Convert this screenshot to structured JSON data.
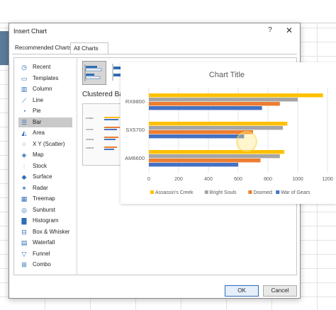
{
  "dialog": {
    "title": "Insert Chart",
    "help_glyph": "?",
    "close_glyph": "✕",
    "tabs": [
      {
        "label": "Recommended Charts"
      },
      {
        "label": "All Charts"
      }
    ],
    "categories": [
      {
        "label": "Recent",
        "icon": "recent-icon"
      },
      {
        "label": "Templates",
        "icon": "templates-icon"
      },
      {
        "label": "Column",
        "icon": "column-chart-icon"
      },
      {
        "label": "Line",
        "icon": "line-chart-icon"
      },
      {
        "label": "Pie",
        "icon": "pie-chart-icon"
      },
      {
        "label": "Bar",
        "icon": "bar-chart-icon",
        "selected": true
      },
      {
        "label": "Area",
        "icon": "area-chart-icon"
      },
      {
        "label": "X Y (Scatter)",
        "icon": "scatter-chart-icon"
      },
      {
        "label": "Map",
        "icon": "map-chart-icon"
      },
      {
        "label": "Stock",
        "icon": "stock-chart-icon"
      },
      {
        "label": "Surface",
        "icon": "surface-chart-icon"
      },
      {
        "label": "Radar",
        "icon": "radar-chart-icon"
      },
      {
        "label": "Treemap",
        "icon": "treemap-chart-icon"
      },
      {
        "label": "Sunburst",
        "icon": "sunburst-chart-icon"
      },
      {
        "label": "Histogram",
        "icon": "histogram-chart-icon"
      },
      {
        "label": "Box & Whisker",
        "icon": "box-whisker-chart-icon"
      },
      {
        "label": "Waterfall",
        "icon": "waterfall-chart-icon"
      },
      {
        "label": "Funnel",
        "icon": "funnel-chart-icon"
      },
      {
        "label": "Combo",
        "icon": "combo-chart-icon"
      }
    ],
    "type_name": "Clustered Ba",
    "ok_label": "OK",
    "cancel_label": "Cancel"
  },
  "colors": {
    "assassins_creek": "#ffc000",
    "bright_souls": "#a5a5a5",
    "doomed": "#ed7d31",
    "war_of_gears": "#4472c4",
    "accent": "#2f6db5"
  },
  "chart_data": {
    "type": "bar",
    "orientation": "horizontal",
    "title": "Chart Title",
    "categories": [
      "AM6600",
      "SX5700",
      "RX8800"
    ],
    "series": [
      {
        "name": "Assassin's Creek",
        "values": [
          910,
          930,
          1170
        ]
      },
      {
        "name": "Bright Souls",
        "values": [
          880,
          900,
          1000
        ]
      },
      {
        "name": "Doomed",
        "values": [
          750,
          700,
          880
        ]
      },
      {
        "name": "War of Gears",
        "values": [
          600,
          640,
          760
        ]
      }
    ],
    "xlim": [
      0,
      1200
    ],
    "xticks": [
      0,
      200,
      400,
      600,
      800,
      1000,
      1200
    ],
    "grid": true,
    "legend": "bottom"
  }
}
